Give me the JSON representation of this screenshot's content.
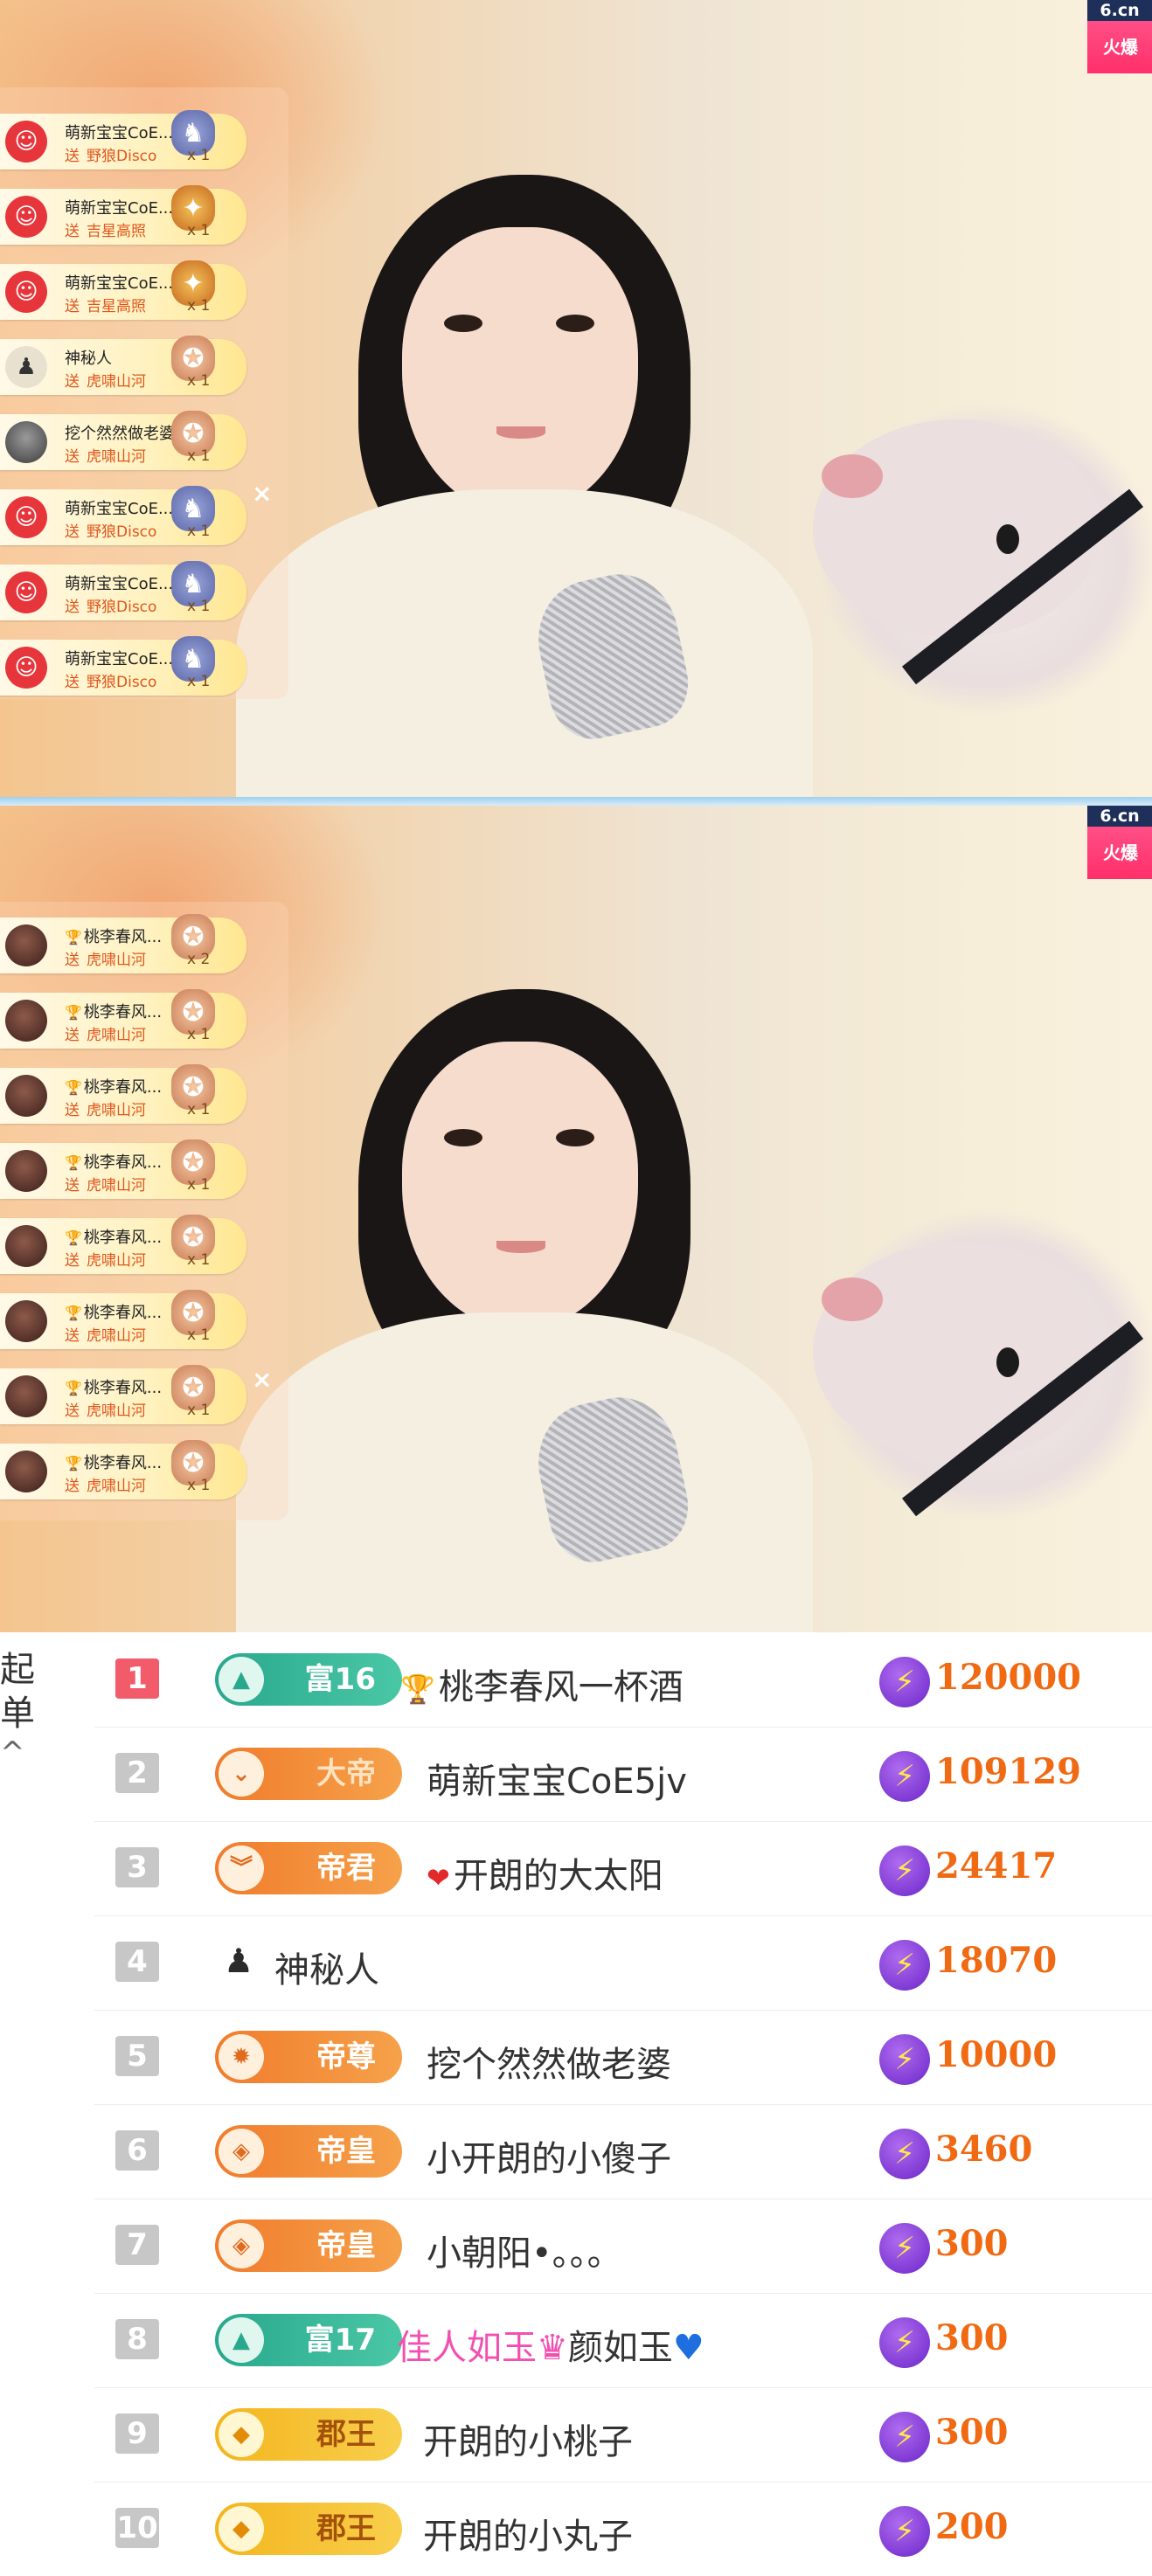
{
  "stream_top": {
    "logo": {
      "badge": "6.cn",
      "name": "火爆"
    },
    "gifts": [
      {
        "user": "萌新宝宝CoE...",
        "gift": "野狼Disco",
        "count": "x 1",
        "avatar": "red",
        "icon": "disco"
      },
      {
        "user": "萌新宝宝CoE...",
        "gift": "吉星高照",
        "count": "x 1",
        "avatar": "red",
        "icon": "luck"
      },
      {
        "user": "萌新宝宝CoE...",
        "gift": "吉星高照",
        "count": "x 1",
        "avatar": "red",
        "icon": "luck"
      },
      {
        "user": "神秘人",
        "gift": "虎啸山河",
        "count": "x 1",
        "avatar": "mys",
        "icon": "tiger"
      },
      {
        "user": "挖个然然做老婆",
        "gift": "虎啸山河",
        "count": "x 1",
        "avatar": "photo",
        "icon": "tiger"
      },
      {
        "user": "萌新宝宝CoE...",
        "gift": "野狼Disco",
        "count": "x 1",
        "avatar": "red",
        "icon": "disco"
      },
      {
        "user": "萌新宝宝CoE...",
        "gift": "野狼Disco",
        "count": "x 1",
        "avatar": "red",
        "icon": "disco"
      },
      {
        "user": "萌新宝宝CoE...",
        "gift": "野狼Disco",
        "count": "x 1",
        "avatar": "red",
        "icon": "disco"
      }
    ],
    "send_label": "送",
    "close": "×"
  },
  "stream_bottom": {
    "logo": {
      "badge": "6.cn",
      "name": "火爆"
    },
    "gifts": [
      {
        "user": "桃李春风...",
        "gift": "虎啸山河",
        "count": "x 2"
      },
      {
        "user": "桃李春风...",
        "gift": "虎啸山河",
        "count": "x 1"
      },
      {
        "user": "桃李春风...",
        "gift": "虎啸山河",
        "count": "x 1"
      },
      {
        "user": "桃李春风...",
        "gift": "虎啸山河",
        "count": "x 1"
      },
      {
        "user": "桃李春风...",
        "gift": "虎啸山河",
        "count": "x 1"
      },
      {
        "user": "桃李春风...",
        "gift": "虎啸山河",
        "count": "x 1"
      },
      {
        "user": "桃李春风...",
        "gift": "虎啸山河",
        "count": "x 1"
      },
      {
        "user": "桃李春风...",
        "gift": "虎啸山河",
        "count": "x 1"
      }
    ],
    "send_label": "送",
    "close": "×"
  },
  "ranking": {
    "side_label_line1": "起",
    "side_label_line2": "单",
    "collapse_icon": "^",
    "rows": [
      {
        "rank": "1",
        "badge": "富16",
        "badge_style": "rich",
        "name": "桃李春风一杯酒",
        "prefix": "trophy",
        "score": "120000"
      },
      {
        "rank": "2",
        "badge": "大帝",
        "badge_style": "orange",
        "name": "萌新宝宝CoE5jv",
        "score": "109129"
      },
      {
        "rank": "3",
        "badge": "帝君",
        "badge_style": "orange",
        "name": "开朗的大太阳",
        "prefix": "heart",
        "score": "24417"
      },
      {
        "rank": "4",
        "badge": "",
        "name": "神秘人",
        "score": "18070"
      },
      {
        "rank": "5",
        "badge": "帝尊",
        "badge_style": "orange",
        "name": "挖个然然做老婆",
        "score": "10000"
      },
      {
        "rank": "6",
        "badge": "帝皇",
        "badge_style": "orange",
        "name": "小开朗的小傻子",
        "score": "3460"
      },
      {
        "rank": "7",
        "badge": "帝皇",
        "badge_style": "orange",
        "name": "小朝阳•。。。",
        "score": "300"
      },
      {
        "rank": "8",
        "badge": "富17",
        "badge_style": "rich",
        "name_part1": "佳人如玉",
        "name_part2": "颜如玉",
        "score": "300"
      },
      {
        "rank": "9",
        "badge": "郡王",
        "badge_style": "gold",
        "name": "开朗的小桃子",
        "score": "300"
      },
      {
        "rank": "10",
        "badge": "郡王",
        "badge_style": "gold",
        "name": "开朗的小丸子",
        "score": "200"
      }
    ]
  },
  "colors": {
    "accent_orange": "#f06a14",
    "first_rank": "#f25b6a",
    "rich_badge": "#2aa88e"
  }
}
